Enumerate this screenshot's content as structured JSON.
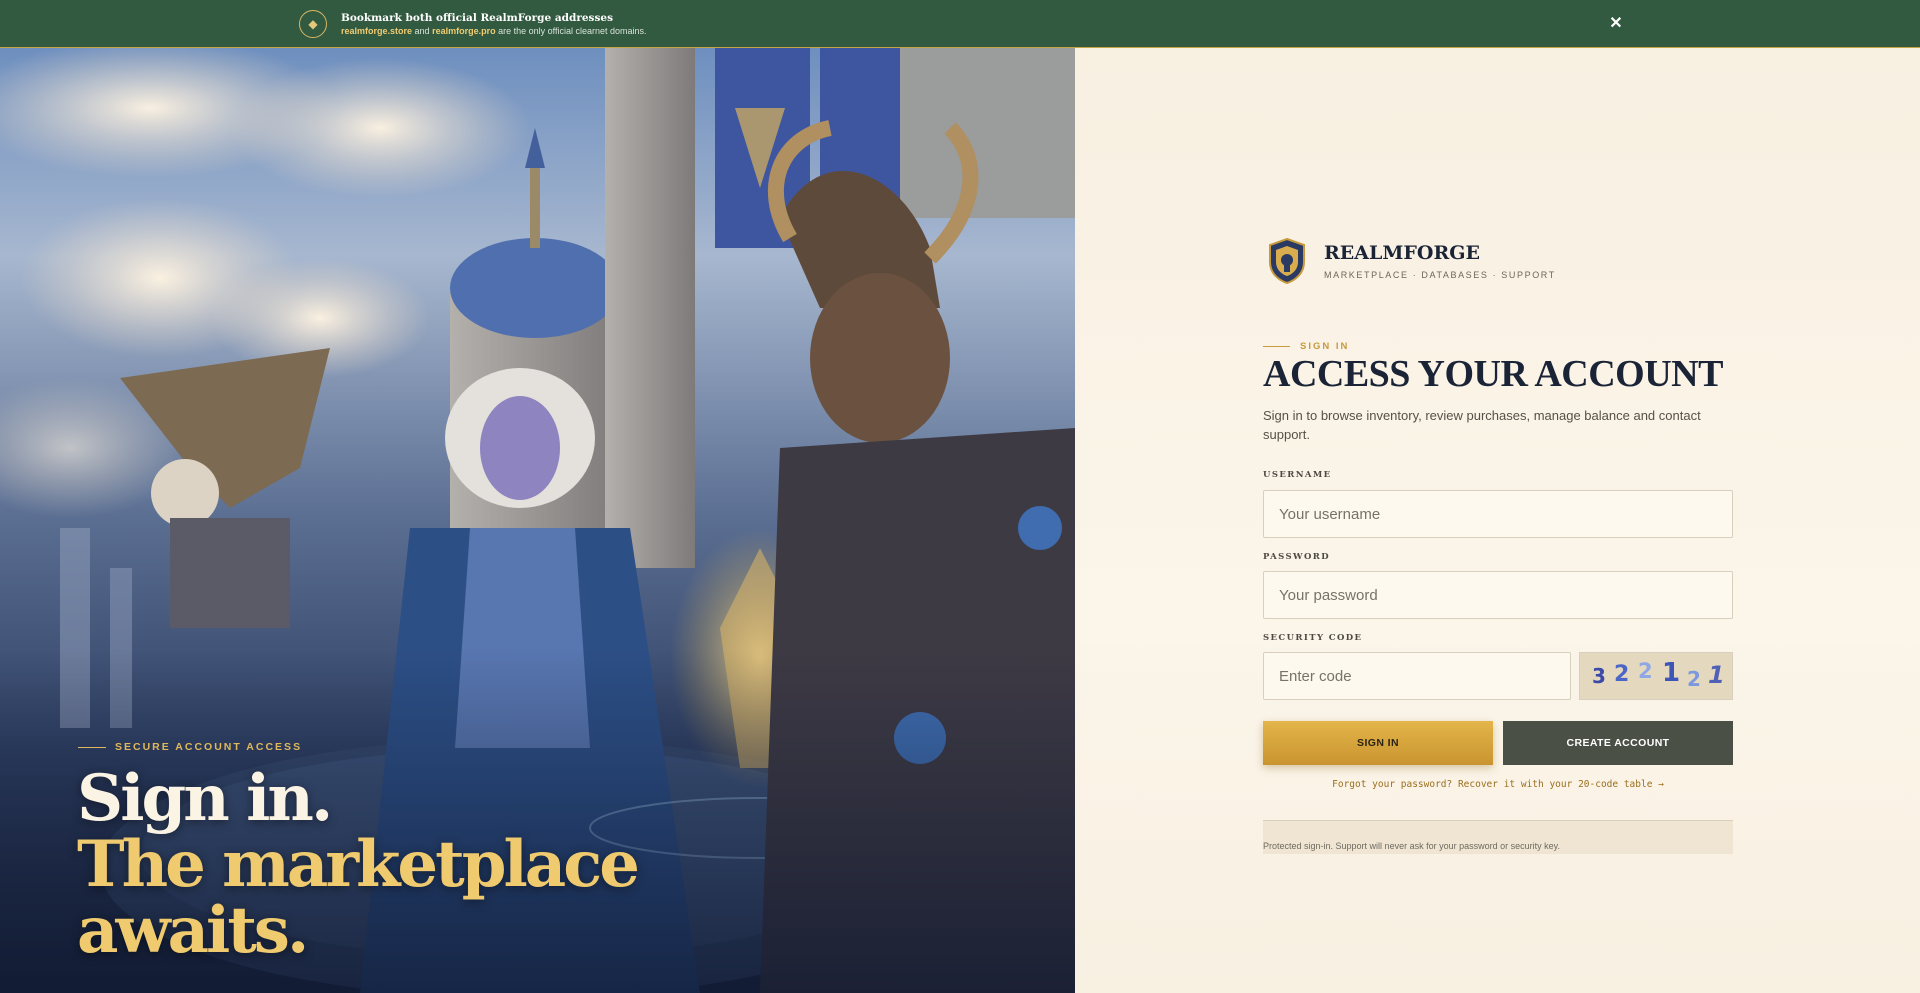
{
  "banner": {
    "icon": "diamond-icon",
    "title": "Bookmark both official RealmForge addresses",
    "domain_primary": "realmforge.store",
    "conjunction": "and",
    "domain_secondary": "realmforge.pro",
    "suffix": "are the only official clearnet domains.",
    "close_icon": "close-icon",
    "close_label": "✕"
  },
  "hero": {
    "kicker": "SECURE ACCOUNT ACCESS",
    "headline_line1": "Sign in.",
    "headline_line2": "The marketplace",
    "headline_line3": "awaits."
  },
  "brand": {
    "logo_icon": "shield-logo-icon",
    "name": "REALMFORGE",
    "tagline": "MARKETPLACE · DATABASES · SUPPORT"
  },
  "form": {
    "kicker": "SIGN IN",
    "title": "ACCESS YOUR ACCOUNT",
    "lead": "Sign in to browse inventory, review purchases, manage balance and contact support.",
    "username_label": "USERNAME",
    "username_placeholder": "Your username",
    "password_label": "PASSWORD",
    "password_placeholder": "Your password",
    "security_label": "SECURITY CODE",
    "security_placeholder": "Enter code",
    "captcha_digits": [
      "3",
      "2",
      "2",
      "1",
      "2",
      "1"
    ],
    "signin_label": "SIGN IN",
    "create_label": "CREATE ACCOUNT",
    "forgot_text": "Forgot your password? Recover it with your 20-code table →",
    "notice": "Protected sign-in. Support will never ask for your password or security key."
  },
  "colors": {
    "banner_bg": "#325a40",
    "accent_gold": "#c79a3c",
    "panel_bg": "#f8f1e3",
    "ink": "#1b2436",
    "create_btn": "#4b5046"
  }
}
